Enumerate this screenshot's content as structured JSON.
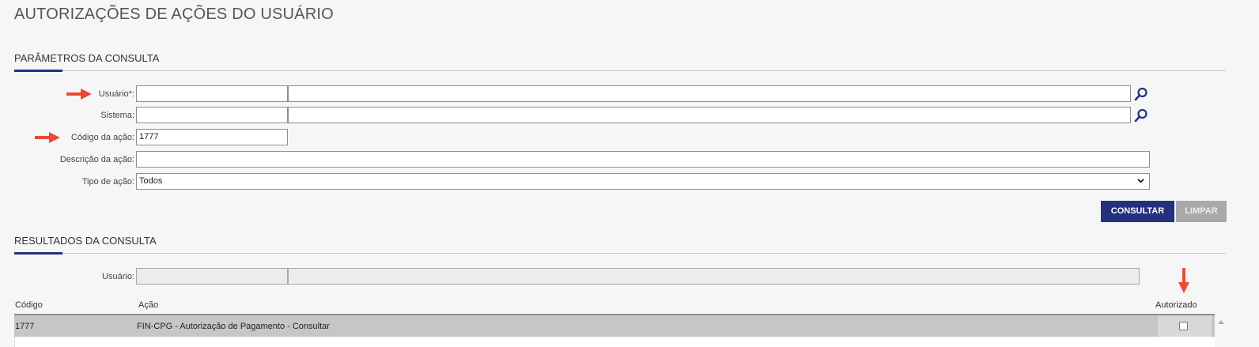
{
  "page": {
    "title": "AUTORIZAÇÕES DE AÇÕES DO USUÁRIO"
  },
  "params": {
    "section_title": "PARÂMETROS DA CONSULTA",
    "usuario_label": "Usuário*:",
    "usuario_code": "",
    "usuario_name": "",
    "sistema_label": "Sistema:",
    "sistema_code": "",
    "sistema_name": "",
    "codigo_label": "Código da ação:",
    "codigo_value": "1777",
    "descricao_label": "Descrição da ação:",
    "descricao_value": "",
    "tipo_label": "Tipo de ação:",
    "tipo_value": "Todos",
    "consultar_label": "CONSULTAR",
    "limpar_label": "LIMPAR"
  },
  "results": {
    "section_title": "RESULTADOS DA CONSULTA",
    "usuario_label": "Usuário:",
    "usuario_code": "",
    "usuario_name": "",
    "columns": {
      "codigo": "Código",
      "acao": "Ação",
      "autorizado": "Autorizado"
    },
    "rows": [
      {
        "codigo": "1777",
        "acao": "FIN-CPG - Autorização de Pagamento - Consultar",
        "autorizado": false
      }
    ]
  },
  "colors": {
    "accent": "#25317e",
    "arrow": "#e8493a",
    "disabled_button": "#a9a9a9"
  },
  "icons": {
    "search": "magnifier-icon",
    "dropdown": "chevron-down-icon",
    "annotation": "red-arrow"
  }
}
